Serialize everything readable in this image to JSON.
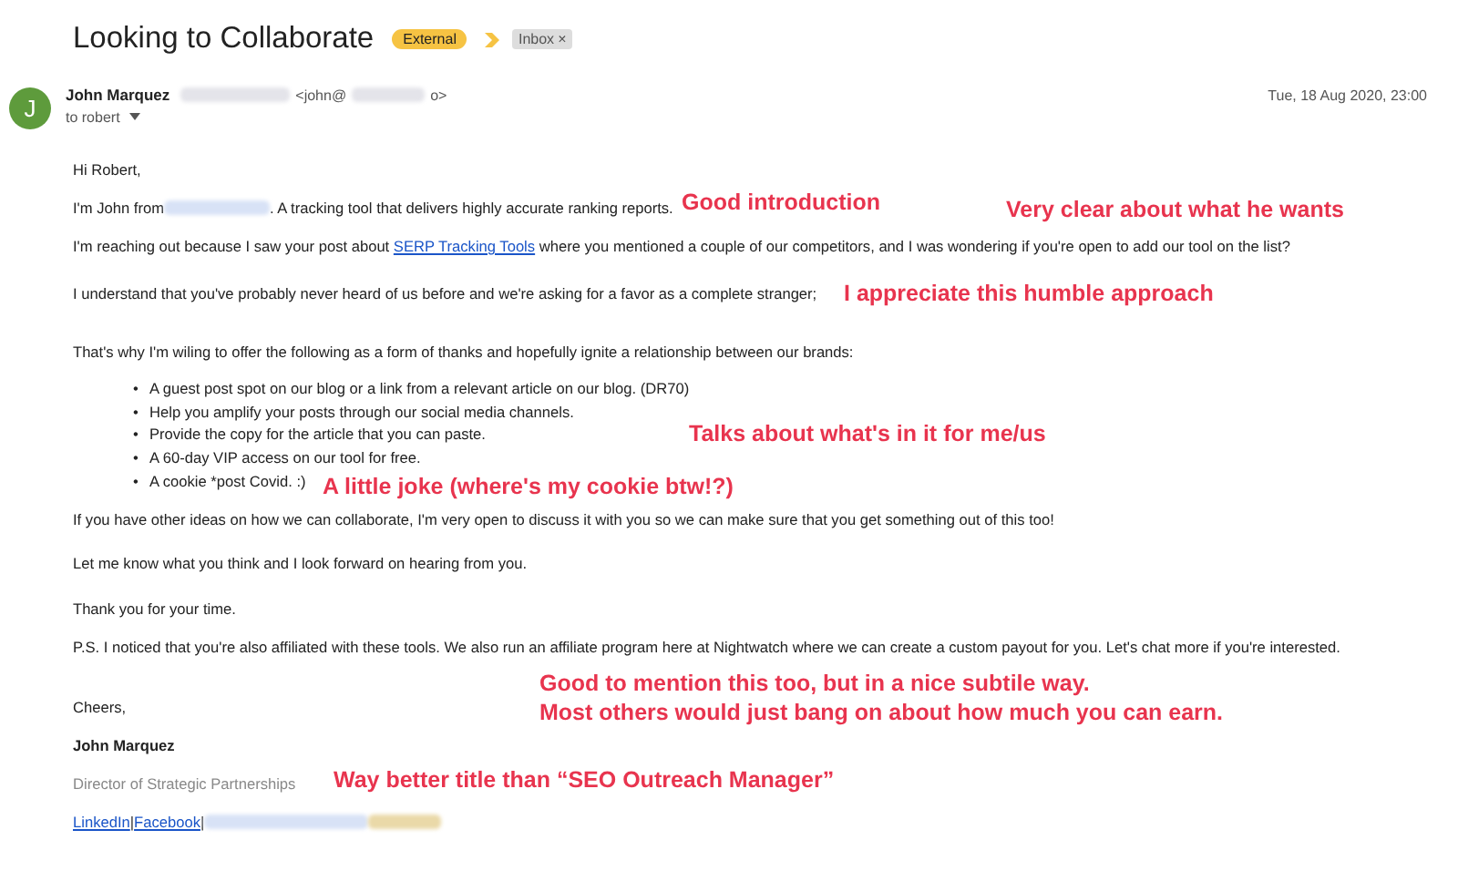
{
  "email": {
    "subject": "Looking to Collaborate",
    "labels": [
      {
        "text": "External",
        "kind": "tag",
        "removable": false
      },
      {
        "text": "Inbox",
        "kind": "chip",
        "removable": true
      }
    ],
    "remove_symbol": "×"
  },
  "sender": {
    "initial": "J",
    "name": "John Marquez",
    "address_start": "<john@",
    "address_end": "o>",
    "recipient": "to robert",
    "date": "Tue, 18 Aug 2020, 23:00"
  },
  "body": [
    {
      "kind": "text",
      "text": "Hi Robert,"
    },
    {
      "kind": "redacted",
      "before": "I'm John from",
      "after": ". A tracking tool that delivers highly accurate ranking reports."
    },
    {
      "kind": "link",
      "before": "I'm reaching out because I saw your post about",
      "link": "SERP Tracking Tools",
      "after": "where you mentioned a couple of our competitors, and I was wondering if you're open to add our tool on the list?"
    },
    {
      "kind": "text",
      "text": "I understand that you've probably never heard of us before and we're asking for a favor as a complete stranger;"
    },
    {
      "kind": "text",
      "text": "That's why I'm wiling to offer the following as a form of thanks and hopefully ignite a relationship between our brands:"
    },
    {
      "kind": "bullets",
      "marker": "•",
      "items": [
        "A guest post spot on our blog or a link from a relevant article on our blog. (DR70)",
        "Help you amplify your posts through our social media channels.",
        "Provide the copy for the article that you can paste.",
        "A 60-day VIP access on our tool for free.",
        "A cookie *post Covid. :)"
      ]
    },
    {
      "kind": "text",
      "text": "If you have other ideas on how we can collaborate, I'm very open to discuss it with you so we can make sure that you get something out of this too!"
    },
    {
      "kind": "text",
      "text": "Let me know what you think and I look forward on hearing from you."
    },
    {
      "kind": "text",
      "text": "Thank you for your time."
    },
    {
      "kind": "text",
      "text": "P.S. I noticed that you're also affiliated with these tools. We also run an affiliate program here at Nightwatch where we can create a custom payout for you. Let's chat more if you're interested."
    },
    {
      "kind": "text",
      "text": "Cheers,"
    },
    {
      "kind": "name",
      "text": "John Marquez"
    },
    {
      "kind": "role",
      "text": "Director of Strategic Partnerships"
    },
    {
      "kind": "links",
      "links": [
        "LinkedIn",
        "Facebook"
      ],
      "separator": "|"
    }
  ],
  "annotations": [
    {
      "text": "Good introduction"
    },
    {
      "text": "Very clear about what he wants"
    },
    {
      "text": "I appreciate this humble approach"
    },
    {
      "text": "Talks about what's in it for me/us"
    },
    {
      "text": "A little joke (where's my cookie btw!?)"
    },
    {
      "text": "Good to mention this too, but in a nice subtile way.\nMost others would just bang on about how much you can earn."
    },
    {
      "text": "Way better title than “SEO Outreach Manager”"
    }
  ]
}
